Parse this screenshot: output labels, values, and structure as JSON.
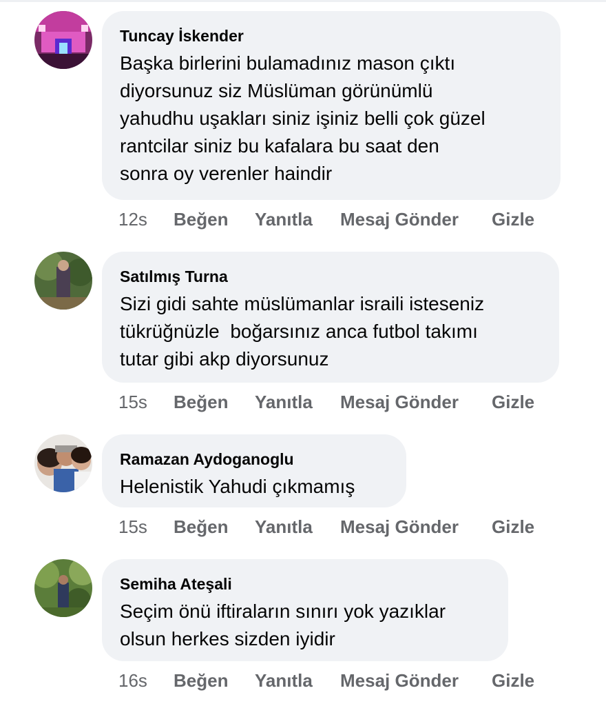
{
  "comments": [
    {
      "author": "Tuncay İskender",
      "text": "Başka birlerini bulamadınız mason çıktı\ndiyorsunuz siz Müslüman görünümlü\nyahudhu uşakları siniz işiniz belli çok güzel\nrantcilar siniz bu kafalara bu saat den\nsonra oy verenler haindir",
      "time": "12s",
      "like": "Beğen",
      "reply": "Yanıtla",
      "message": "Mesaj Gönder",
      "hide": "Gizle"
    },
    {
      "author": "Satılmış Turna",
      "text": "Sizi gidi sahte müslümanlar israili isteseniz\ntükrüğnüzle  boğarsınız anca futbol takımı\ntutar gibi akp diyorsunuz",
      "time": "15s",
      "like": "Beğen",
      "reply": "Yanıtla",
      "message": "Mesaj Gönder",
      "hide": "Gizle"
    },
    {
      "author": "Ramazan Aydoganoglu",
      "text": "Helenistik Yahudi çıkmamış",
      "time": "15s",
      "like": "Beğen",
      "reply": "Yanıtla",
      "message": "Mesaj Gönder",
      "hide": "Gizle"
    },
    {
      "author": "Semiha Ateşali",
      "text": "Seçim önü iftiraların sınırı yok yazıklar\nolsun herkes sizden iyidir",
      "time": "16s",
      "like": "Beğen",
      "reply": "Yanıtla",
      "message": "Mesaj Gönder",
      "hide": "Gizle"
    }
  ]
}
